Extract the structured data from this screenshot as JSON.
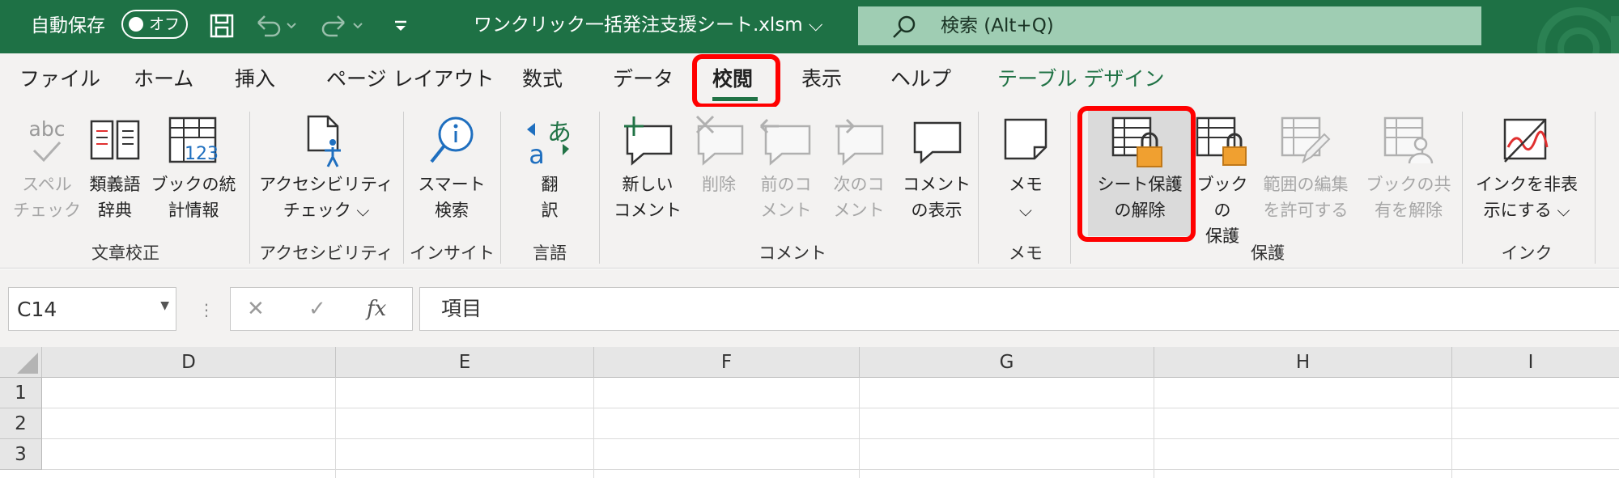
{
  "titlebar": {
    "autosave_label": "自動保存",
    "autosave_state": "オフ",
    "filename": "ワンクリック一括発注支援シート.xlsm",
    "filename_caret": "⌵",
    "search_placeholder": "検索 (Alt+Q)"
  },
  "tabs": [
    {
      "label": "ファイル"
    },
    {
      "label": "ホーム"
    },
    {
      "label": "挿入"
    },
    {
      "label": "ページ レイアウト"
    },
    {
      "label": "数式"
    },
    {
      "label": "データ"
    },
    {
      "label": "校閲",
      "active": true
    },
    {
      "label": "表示"
    },
    {
      "label": "ヘルプ"
    },
    {
      "label": "テーブル デザイン"
    }
  ],
  "ribbon": {
    "groups": {
      "proofing": "文章校正",
      "accessibility": "アクセシビリティ",
      "insights": "インサイト",
      "language": "言語",
      "comments": "コメント",
      "notes": "メモ",
      "protect": "保護",
      "ink": "インク"
    },
    "buttons": {
      "spelling": "スペル\nチェック",
      "thesaurus": "類義語\n辞典",
      "workbook_stats": "ブックの統\n計情報",
      "check_accessibility": "アクセシビリティ\nチェック ⌵",
      "smart_lookup": "スマート\n検索",
      "translate": "翻\n訳",
      "new_comment": "新しい\nコメント",
      "delete_comment": "削除",
      "prev_comment": "前のコ\nメント",
      "next_comment": "次のコ\nメント",
      "show_comments": "コメント\nの表示",
      "notes": "メモ\n⌵",
      "unprotect_sheet": "シート保護\nの解除",
      "protect_workbook": "ブックの\n保護",
      "allow_edit_ranges": "範囲の編集\nを許可する",
      "unshare_workbook": "ブックの共\n有を解除",
      "hide_ink": "インクを非表\n示にする ⌵"
    },
    "icon_text": {
      "abc": "abc",
      "num": "123",
      "ja": "あ",
      "en": "a"
    }
  },
  "formula_bar": {
    "name_box": "C14",
    "cancel": "✕",
    "enter": "✓",
    "fx": "fx",
    "value": "項目"
  },
  "grid": {
    "columns": [
      "D",
      "E",
      "F",
      "G",
      "H",
      "I"
    ],
    "rows": [
      "1",
      "2",
      "3"
    ]
  },
  "colors": {
    "title_green": "#1e7145",
    "accent_green": "#217346",
    "highlight_red": "#ff0000",
    "lock_orange": "#f0a030"
  }
}
